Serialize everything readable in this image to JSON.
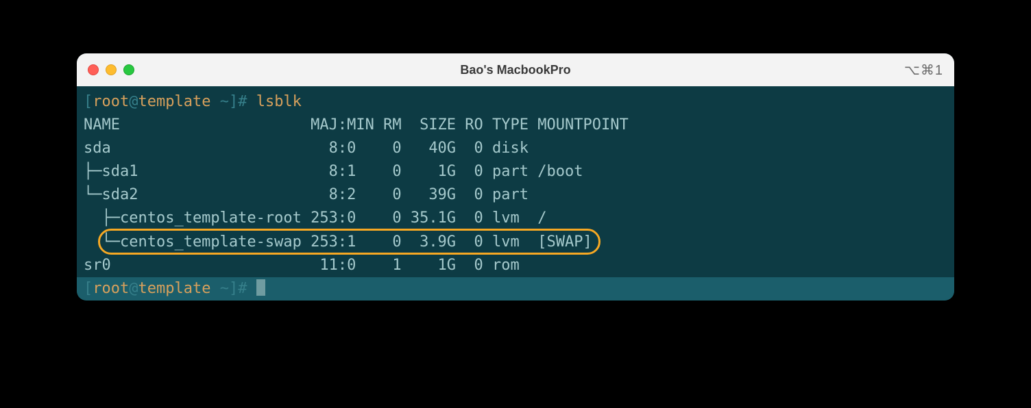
{
  "window": {
    "title": "Bao's MacbookPro",
    "shortcut": "⌥⌘1"
  },
  "colors": {
    "highlight": "#f7a823"
  },
  "prompt": {
    "open": "[",
    "user": "root",
    "at": "@",
    "host": "template",
    "cwd": " ~",
    "close": "]# ",
    "cmd1": "lsblk",
    "cmd2": ""
  },
  "header": "NAME                     MAJ:MIN RM  SIZE RO TYPE MOUNTPOINT",
  "rows": [
    "sda                        8:0    0   40G  0 disk ",
    "├─sda1                     8:1    0    1G  0 part /boot",
    "└─sda2                     8:2    0   39G  0 part ",
    "  ├─centos_template-root 253:0    0 35.1G  0 lvm  /",
    "  └─centos_template-swap 253:1    0  3.9G  0 lvm  [SWAP]",
    "sr0                       11:0    1    1G  0 rom  "
  ],
  "highlight": {
    "row_index": 4
  }
}
